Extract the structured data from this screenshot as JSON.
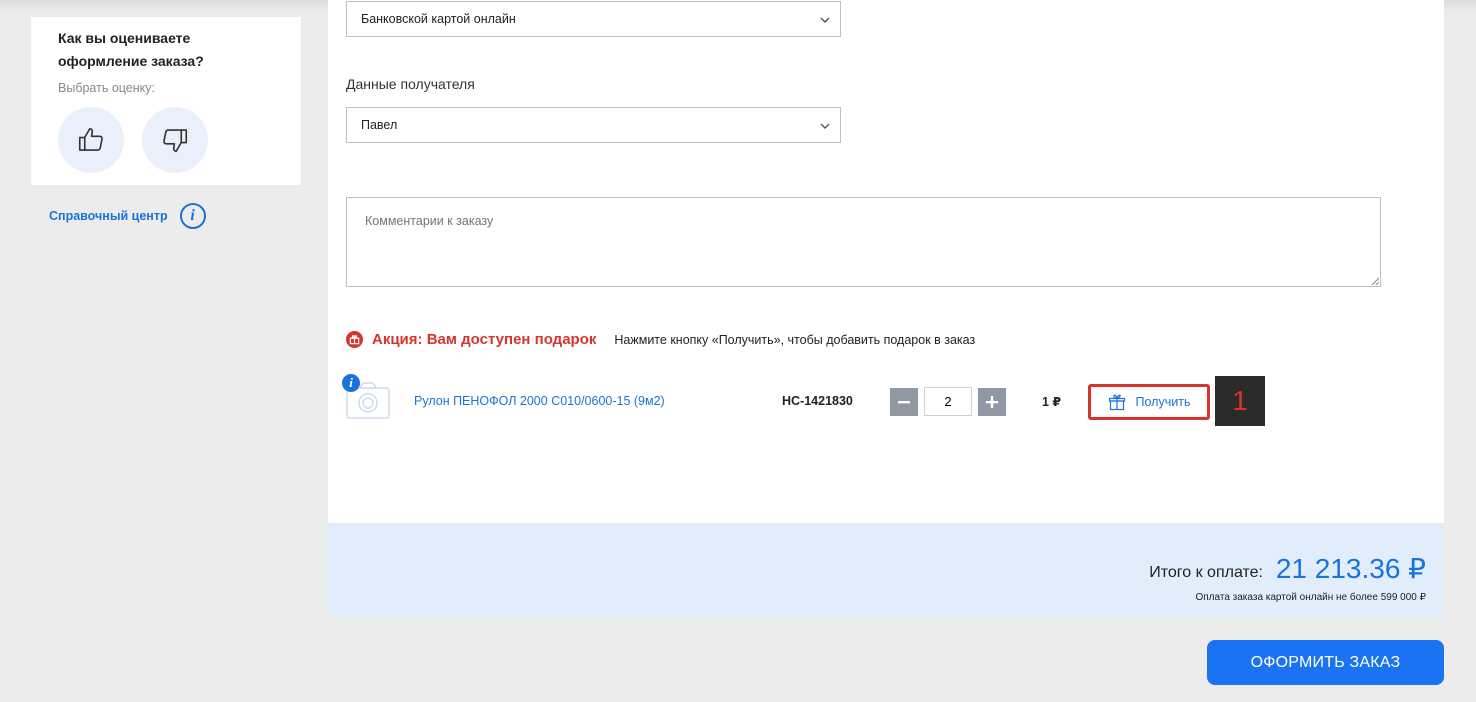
{
  "rating": {
    "title": "Как вы оцениваете оформление заказа?",
    "subtitle": "Выбрать оценку:",
    "like_icon": "thumbs-up-icon",
    "dislike_icon": "thumbs-down-icon"
  },
  "help": {
    "label": "Справочный центр",
    "icon_glyph": "i"
  },
  "payment": {
    "selected": "Банковской картой онлайн"
  },
  "recipient": {
    "label": "Данные получателя",
    "selected": "Павел"
  },
  "comment": {
    "placeholder": "Комментарии к заказу"
  },
  "promo": {
    "title": "Акция: Вам доступен подарок",
    "hint": "Нажмите кнопку «Получить», чтобы добавить подарок в заказ"
  },
  "gift_item": {
    "info_glyph": "i",
    "name": "Рулон ПЕНОФОЛ 2000 С010/0600-15 (9м2)",
    "code": "НС-1421830",
    "quantity": "2",
    "price": "1 ₽",
    "get_label": "Получить",
    "marker": "1"
  },
  "total": {
    "label": "Итого к оплате:",
    "amount": "21 213.36 ₽",
    "note": "Оплата заказа картой онлайн не более 599 000 ₽"
  },
  "order_button": "ОФОРМИТЬ ЗАКАЗ",
  "colors": {
    "accent": "#1a73d9",
    "promo_red": "#d9342b",
    "total_bg": "#e1edfb",
    "order_btn": "#1a73f0"
  }
}
